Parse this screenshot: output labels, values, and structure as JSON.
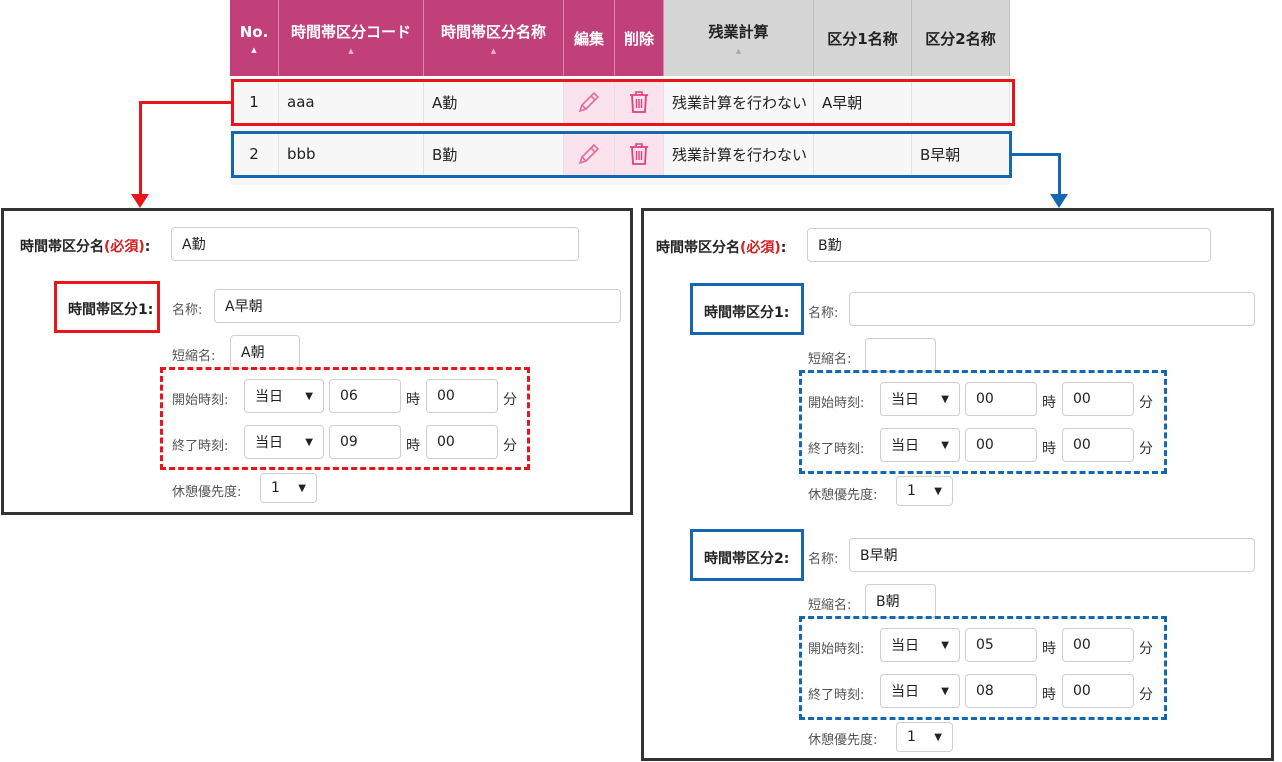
{
  "table": {
    "headers": {
      "no": "No.",
      "code": "時間帯区分コード",
      "name": "時間帯区分名称",
      "edit": "編集",
      "delete": "削除",
      "overtime": "残業計算",
      "div1": "区分1名称",
      "div2": "区分2名称"
    },
    "rows": [
      {
        "no": "1",
        "code": "aaa",
        "name": "A勤",
        "overtime": "残業計算を行わない",
        "div1": "A早朝",
        "div2": ""
      },
      {
        "no": "2",
        "code": "bbb",
        "name": "B勤",
        "overtime": "残業計算を行わない",
        "div1": "",
        "div2": "B早朝"
      }
    ]
  },
  "colors": {
    "header_pink": "#c2407a",
    "highlight_red": "#e8151b",
    "highlight_blue": "#1467b3"
  },
  "icons": {
    "edit": "pencil-icon",
    "delete": "trash-icon"
  },
  "left_form": {
    "name_label": "時間帯区分名",
    "required": "(必須)",
    "colon": ":",
    "name_value": "A勤",
    "div1": {
      "title": "時間帯区分1:",
      "name_label": "名称:",
      "name_value": "A早朝",
      "short_label": "短縮名:",
      "short_value": "A朝",
      "start_label": "開始時刻:",
      "start_day": "当日",
      "start_hour": "06",
      "start_min": "00",
      "end_label": "終了時刻:",
      "end_day": "当日",
      "end_hour": "09",
      "end_min": "00",
      "hour_unit": "時",
      "min_unit": "分",
      "break_label": "休憩優先度:",
      "break_value": "1"
    }
  },
  "right_form": {
    "name_label": "時間帯区分名",
    "required": "(必須)",
    "colon": ":",
    "name_value": "B勤",
    "div1": {
      "title": "時間帯区分1:",
      "name_label": "名称:",
      "name_value": "",
      "short_label": "短縮名:",
      "short_value": "",
      "start_label": "開始時刻:",
      "start_day": "当日",
      "start_hour": "00",
      "start_min": "00",
      "end_label": "終了時刻:",
      "end_day": "当日",
      "end_hour": "00",
      "end_min": "00",
      "hour_unit": "時",
      "min_unit": "分",
      "break_label": "休憩優先度:",
      "break_value": "1"
    },
    "div2": {
      "title": "時間帯区分2:",
      "name_label": "名称:",
      "name_value": "B早朝",
      "short_label": "短縮名:",
      "short_value": "B朝",
      "start_label": "開始時刻:",
      "start_day": "当日",
      "start_hour": "05",
      "start_min": "00",
      "end_label": "終了時刻:",
      "end_day": "当日",
      "end_hour": "08",
      "end_min": "00",
      "hour_unit": "時",
      "min_unit": "分",
      "break_label": "休憩優先度:",
      "break_value": "1"
    }
  }
}
